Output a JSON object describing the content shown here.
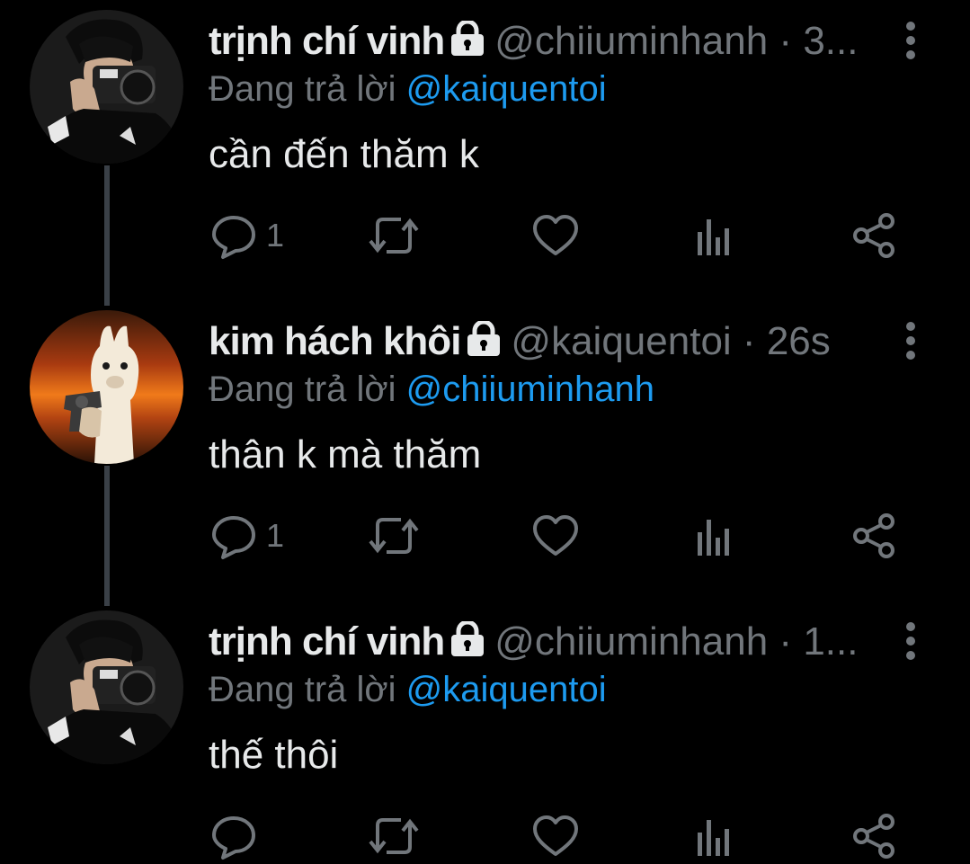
{
  "tweets": [
    {
      "name": "trịnh chí vinh",
      "handle": "@chiiuminhanh",
      "dot": "·",
      "time": "3...",
      "replying_prefix": "Đang trả lời",
      "replying_to": "@kaiquentoi",
      "text": "cần đến thăm k",
      "reply_count": "1",
      "avatar": "photographer-avatar"
    },
    {
      "name": "kim hách khôi",
      "handle": "@kaiquentoi",
      "dot": "·",
      "time": "26s",
      "replying_prefix": "Đang trả lời",
      "replying_to": "@chiiuminhanh",
      "text": "thân k mà thăm",
      "reply_count": "1",
      "avatar": "alpaca-with-gun-avatar"
    },
    {
      "name": "trịnh chí vinh",
      "handle": "@chiiuminhanh",
      "dot": "·",
      "time": "1...",
      "replying_prefix": "Đang trả lời",
      "replying_to": "@kaiquentoi",
      "text": "thế thôi",
      "reply_count": "",
      "avatar": "photographer-avatar"
    }
  ],
  "icons": [
    "lock-icon",
    "more-icon",
    "reply-icon",
    "retweet-icon",
    "like-icon",
    "views-icon",
    "share-icon"
  ],
  "colors": {
    "background": "#000000",
    "text": "#e7e9ea",
    "muted": "#71767b",
    "mention": "#1d9bf0",
    "thread_line": "#3a4047"
  }
}
